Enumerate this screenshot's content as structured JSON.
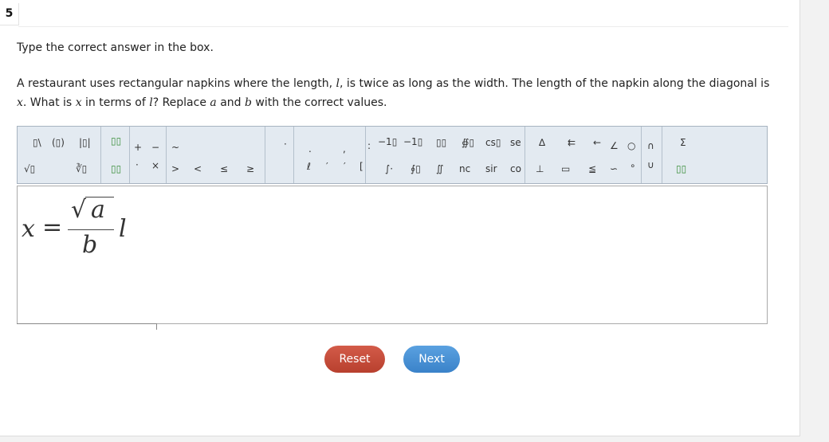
{
  "question_number": "5",
  "instruction": "Type the correct answer in the box.",
  "question": {
    "part1": "A restaurant uses rectangular napkins where the length, ",
    "var_l": "l",
    "part2": ", is twice as long as the width. The length of the napkin along the diagonal is ",
    "var_x": "x",
    "part3": ". What is ",
    "var_x2": "x",
    "part4": " in terms of ",
    "var_l2": "l",
    "part5": "? Replace ",
    "var_a": "a",
    "part6": " and ",
    "var_b": "b",
    "part7": " with the correct values."
  },
  "toolbar": {
    "row1": [
      "▯\\",
      "(▯)",
      "|▯|",
      "▯▯",
      "+",
      "−",
      "~",
      "·",
      ".",
      ",",
      ":",
      "−1▯",
      "−1▯",
      "▯▯",
      "∯▯",
      "cs▯",
      "se",
      "∆",
      "⇇",
      "←",
      "∠",
      "○",
      "∩",
      "Σ"
    ],
    "row2": [
      "√▯",
      "∛▯",
      "▯▯",
      "·",
      "×",
      ">",
      "<",
      "≤",
      "≥",
      "ℓ",
      "′",
      "′",
      "[",
      "∫·",
      "∮▯",
      "∬",
      "nc",
      "sir",
      "co",
      "⊥",
      "▭",
      "≦",
      "∽",
      "∘",
      "∪",
      "▯▯"
    ]
  },
  "answer": {
    "lhs": "x",
    "equals": "=",
    "radical": "√",
    "numerator": "a",
    "denominator": "b",
    "multiplier": "l"
  },
  "buttons": {
    "reset": "Reset",
    "next": "Next"
  }
}
